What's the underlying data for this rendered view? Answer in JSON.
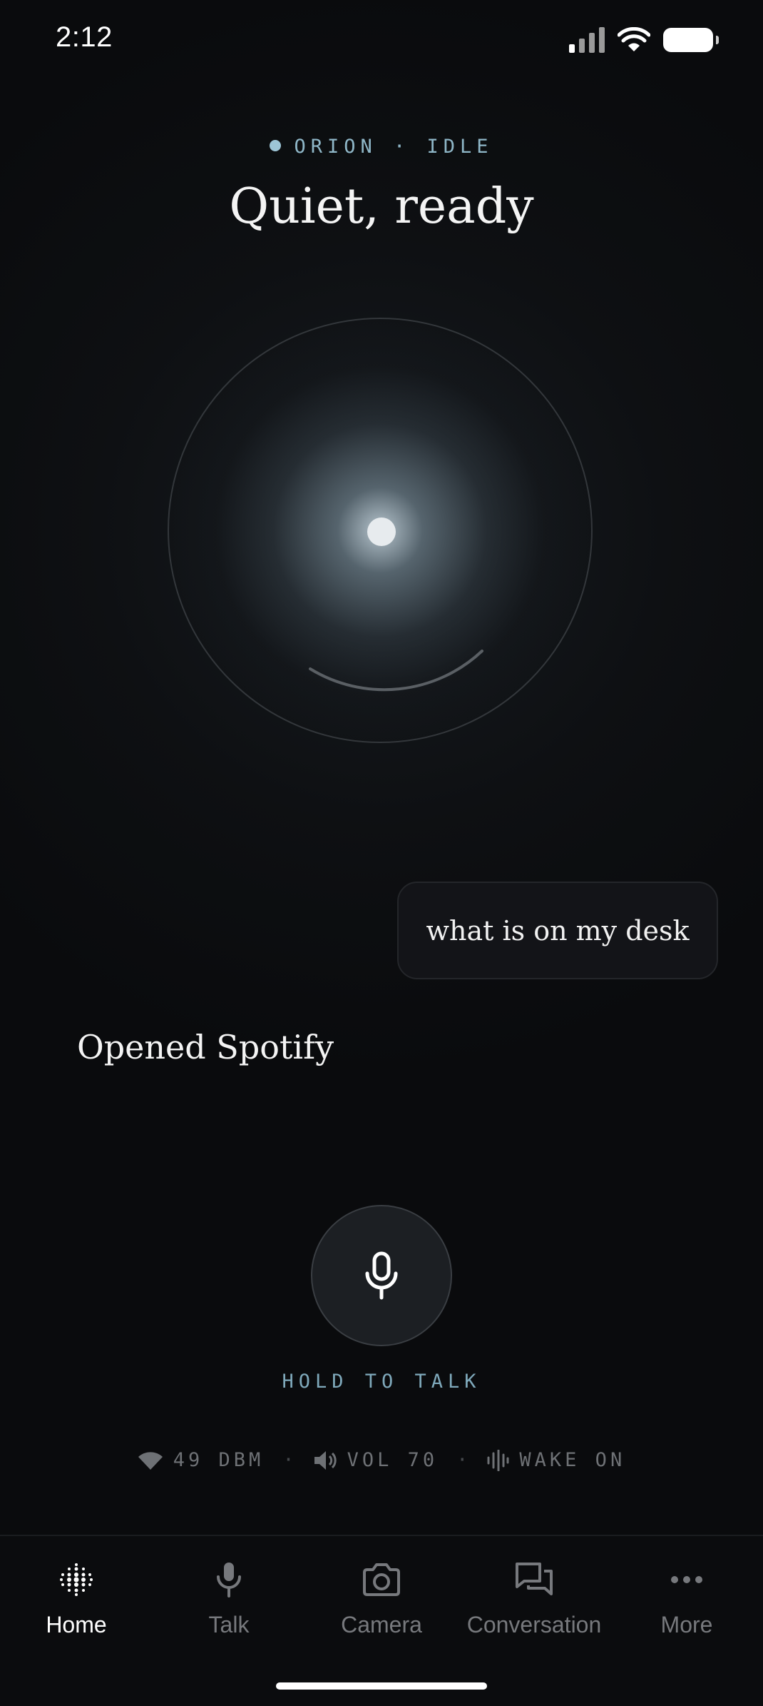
{
  "status_bar": {
    "time": "2:12"
  },
  "header": {
    "assistant_name": "ORION",
    "separator": "·",
    "state": "IDLE",
    "title": "Quiet, ready"
  },
  "conversation": {
    "user_message": "what is on my desk",
    "assistant_reply": "Opened Spotify"
  },
  "mic": {
    "label": "HOLD TO TALK",
    "icon": "microphone-icon"
  },
  "telemetry": {
    "signal": "49 DBM",
    "volume": "VOL 70",
    "wake": "WAKE ON",
    "separator": "·"
  },
  "tabs": [
    {
      "label": "Home",
      "icon": "dots-grid-icon",
      "active": true
    },
    {
      "label": "Talk",
      "icon": "microphone-icon",
      "active": false
    },
    {
      "label": "Camera",
      "icon": "camera-icon",
      "active": false
    },
    {
      "label": "Conversation",
      "icon": "chat-bubbles-icon",
      "active": false
    },
    {
      "label": "More",
      "icon": "ellipsis-icon",
      "active": false
    }
  ],
  "colors": {
    "background": "#0a0b0d",
    "accent": "#8fb7c8",
    "muted": "#6e7175",
    "active_tab": "#ffffff"
  }
}
